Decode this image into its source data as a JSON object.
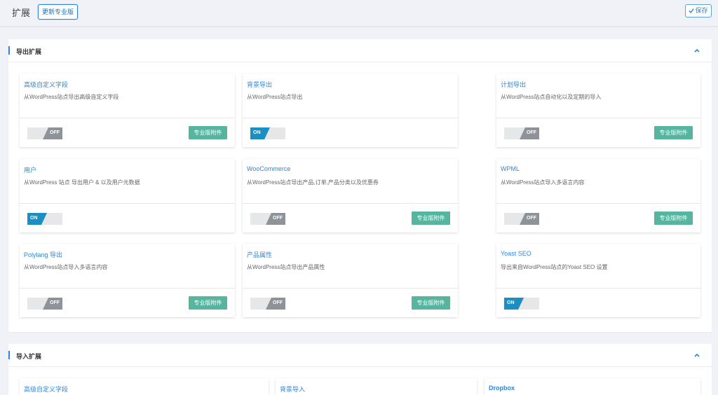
{
  "header": {
    "title": "扩展",
    "upgrade_label": "更新专业版",
    "save_label": "保存"
  },
  "export_section": {
    "title": "导出扩展",
    "cards": [
      {
        "title": "高级自定义字段",
        "desc": "从WordPress站点导出高级自定义字段",
        "state": "off",
        "switch_label": "OFF",
        "pro": true
      },
      {
        "title": "背景导出",
        "desc": "从WordPress站点导出",
        "state": "on",
        "switch_label": "ON",
        "pro": false
      },
      {
        "title": "计划导出",
        "desc": "从WordPress站点自动化以及定期的导入",
        "state": "off",
        "switch_label": "OFF",
        "pro": true
      },
      {
        "title": "用户",
        "desc": "从WordPress 站点 导出用户 & 以及用户元数据",
        "state": "on",
        "switch_label": "ON",
        "pro": false
      },
      {
        "title": "WooCommerce",
        "desc": "从WordPress站点导出产品,订单,产品分类以及优惠券",
        "state": "off",
        "switch_label": "OFF",
        "pro": true
      },
      {
        "title": "WPML",
        "desc": "从WordPress站点导入多语言内容",
        "state": "off",
        "switch_label": "OFF",
        "pro": true
      },
      {
        "title": "Polylang 导出",
        "desc": "从WordPress站点导入多语言内容",
        "state": "off",
        "switch_label": "OFF",
        "pro": true
      },
      {
        "title": "产品属性",
        "desc": "从WordPress站点导出产品属性",
        "state": "off",
        "switch_label": "OFF",
        "pro": true
      },
      {
        "title": "Yoast SEO",
        "desc": "导出来自WordPress站点的Yoast SEO 设置",
        "state": "on",
        "switch_label": "ON",
        "pro": false
      }
    ],
    "pro_label": "专业版附件"
  },
  "import_section": {
    "title": "导入扩展",
    "cards": [
      {
        "title": "高级自定义字段"
      },
      {
        "title": "背景导入"
      },
      {
        "title": "Dropbox"
      }
    ]
  },
  "colors": {
    "accent": "#2f86d6",
    "pro_badge": "#56b49f",
    "switch_on": "#1b8fc4",
    "switch_off": "#8e9399"
  }
}
